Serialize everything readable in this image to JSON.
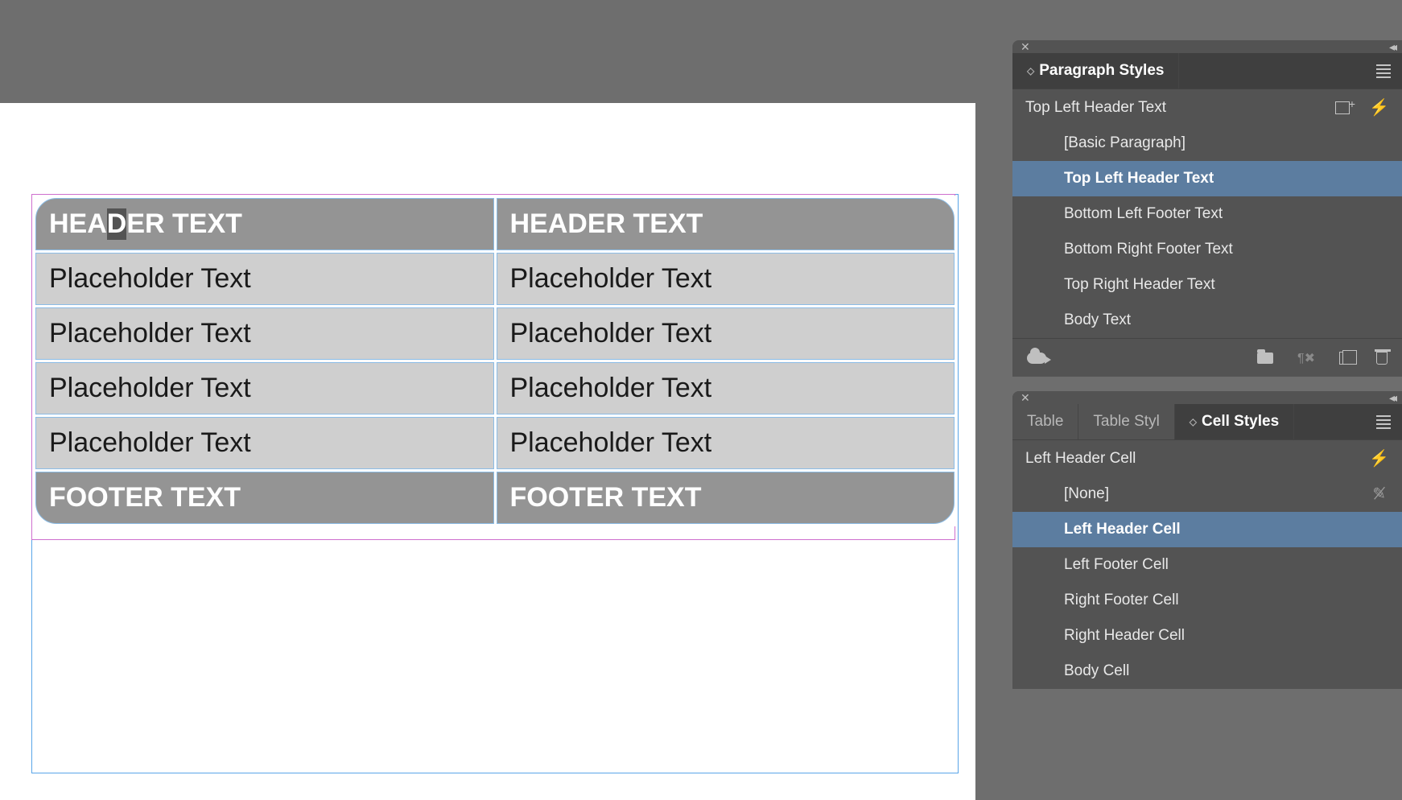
{
  "document": {
    "table": {
      "header": {
        "left": "HEADER TEXT",
        "right": "HEADER TEXT"
      },
      "rows": [
        {
          "left": "Placeholder Text",
          "right": "Placeholder Text"
        },
        {
          "left": "Placeholder Text",
          "right": "Placeholder Text"
        },
        {
          "left": "Placeholder Text",
          "right": "Placeholder Text"
        },
        {
          "left": "Placeholder Text",
          "right": "Placeholder Text"
        }
      ],
      "footer": {
        "left": "FOOTER TEXT",
        "right": "FOOTER TEXT"
      }
    },
    "cursor_in_header_left_char": "D",
    "header_left_pre": "HEA",
    "header_left_post": "ER TEXT"
  },
  "paragraph_panel": {
    "tab_label": "Paragraph Styles",
    "current": "Top Left Header Text",
    "items": [
      {
        "label": "[Basic Paragraph]",
        "selected": false
      },
      {
        "label": "Top Left Header Text",
        "selected": true
      },
      {
        "label": "Bottom Left Footer Text",
        "selected": false
      },
      {
        "label": "Bottom Right Footer Text",
        "selected": false
      },
      {
        "label": "Top Right Header Text",
        "selected": false
      },
      {
        "label": "Body Text",
        "selected": false
      }
    ]
  },
  "cell_panel": {
    "tabs": [
      {
        "label": "Table",
        "active": false
      },
      {
        "label": "Table Styl",
        "active": false
      },
      {
        "label": "Cell Styles",
        "active": true
      }
    ],
    "current": "Left Header Cell",
    "items": [
      {
        "label": "[None]",
        "selected": false,
        "locked": true
      },
      {
        "label": "Left Header Cell",
        "selected": true
      },
      {
        "label": "Left Footer Cell",
        "selected": false
      },
      {
        "label": "Right Footer Cell",
        "selected": false
      },
      {
        "label": "Right Header Cell",
        "selected": false
      },
      {
        "label": "Body Cell",
        "selected": false
      }
    ]
  }
}
